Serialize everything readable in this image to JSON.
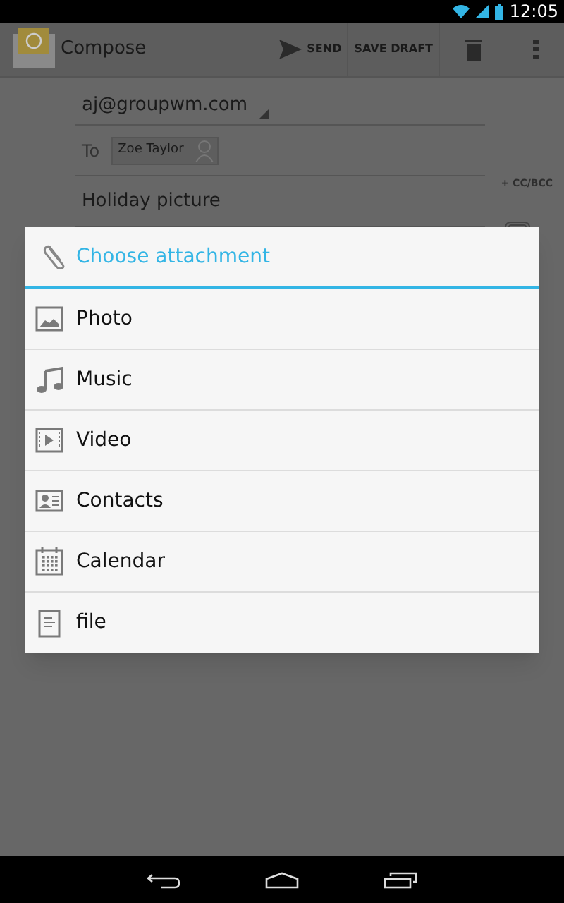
{
  "status_bar": {
    "time": "12:05"
  },
  "action_bar": {
    "title": "Compose",
    "actions": [
      {
        "kind": "send",
        "label": "SEND"
      },
      {
        "kind": "plain",
        "label": "SAVE DRAFT"
      }
    ]
  },
  "compose": {
    "from": "aj@groupwm.com",
    "to_label": "To",
    "recipient": "Zoe Taylor",
    "cc_bcc": "+ CC/BCC",
    "subject": "Holiday picture"
  },
  "dialog": {
    "title": "Choose attachment",
    "items": [
      {
        "kind": "photo",
        "label": "Photo"
      },
      {
        "kind": "music",
        "label": "Music"
      },
      {
        "kind": "video",
        "label": "Video"
      },
      {
        "kind": "contacts",
        "label": "Contacts"
      },
      {
        "kind": "calendar",
        "label": "Calendar"
      },
      {
        "kind": "file",
        "label": "file"
      }
    ]
  }
}
